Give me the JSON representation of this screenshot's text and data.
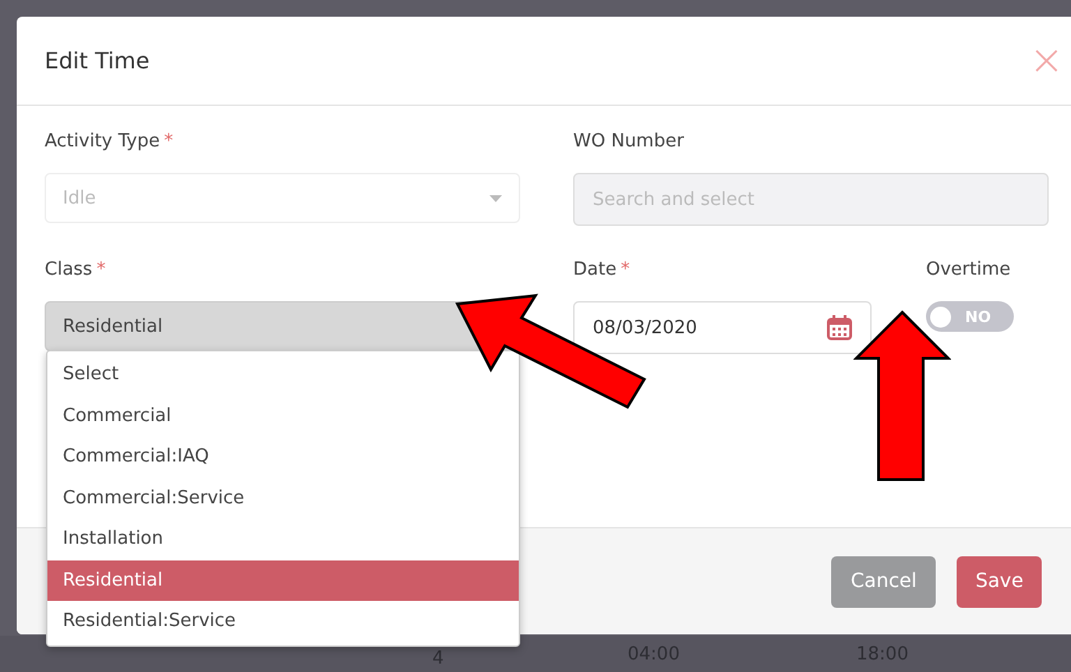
{
  "backdrop_row": {
    "cells": [
      {
        "text": "4"
      },
      {
        "text": "04:00"
      },
      {
        "text": "18:00"
      }
    ]
  },
  "dialog": {
    "title": "Edit Time",
    "close": "×",
    "activity_type": {
      "label": "Activity Type",
      "required_mark": "*",
      "value": "Idle",
      "disabled": true
    },
    "wo_number": {
      "label": "WO Number",
      "placeholder": "Search and select",
      "disabled": true
    },
    "class": {
      "label": "Class",
      "required_mark": "*",
      "value": "Residential",
      "expanded": true,
      "options": [
        {
          "label": "Select",
          "selected": false
        },
        {
          "label": "Commercial",
          "selected": false
        },
        {
          "label": "Commercial:IAQ",
          "selected": false
        },
        {
          "label": "Commercial:Service",
          "selected": false
        },
        {
          "label": "Installation",
          "selected": false
        },
        {
          "label": "Residential",
          "selected": true
        },
        {
          "label": "Residential:Service",
          "selected": false
        }
      ]
    },
    "date": {
      "label": "Date",
      "required_mark": "*",
      "value": "08/03/2020"
    },
    "overtime": {
      "label": "Overtime",
      "on": false,
      "text": "NO"
    },
    "buttons": [
      {
        "label": "Cancel",
        "kind": "secondary"
      },
      {
        "label": "Save",
        "kind": "primary"
      }
    ]
  }
}
